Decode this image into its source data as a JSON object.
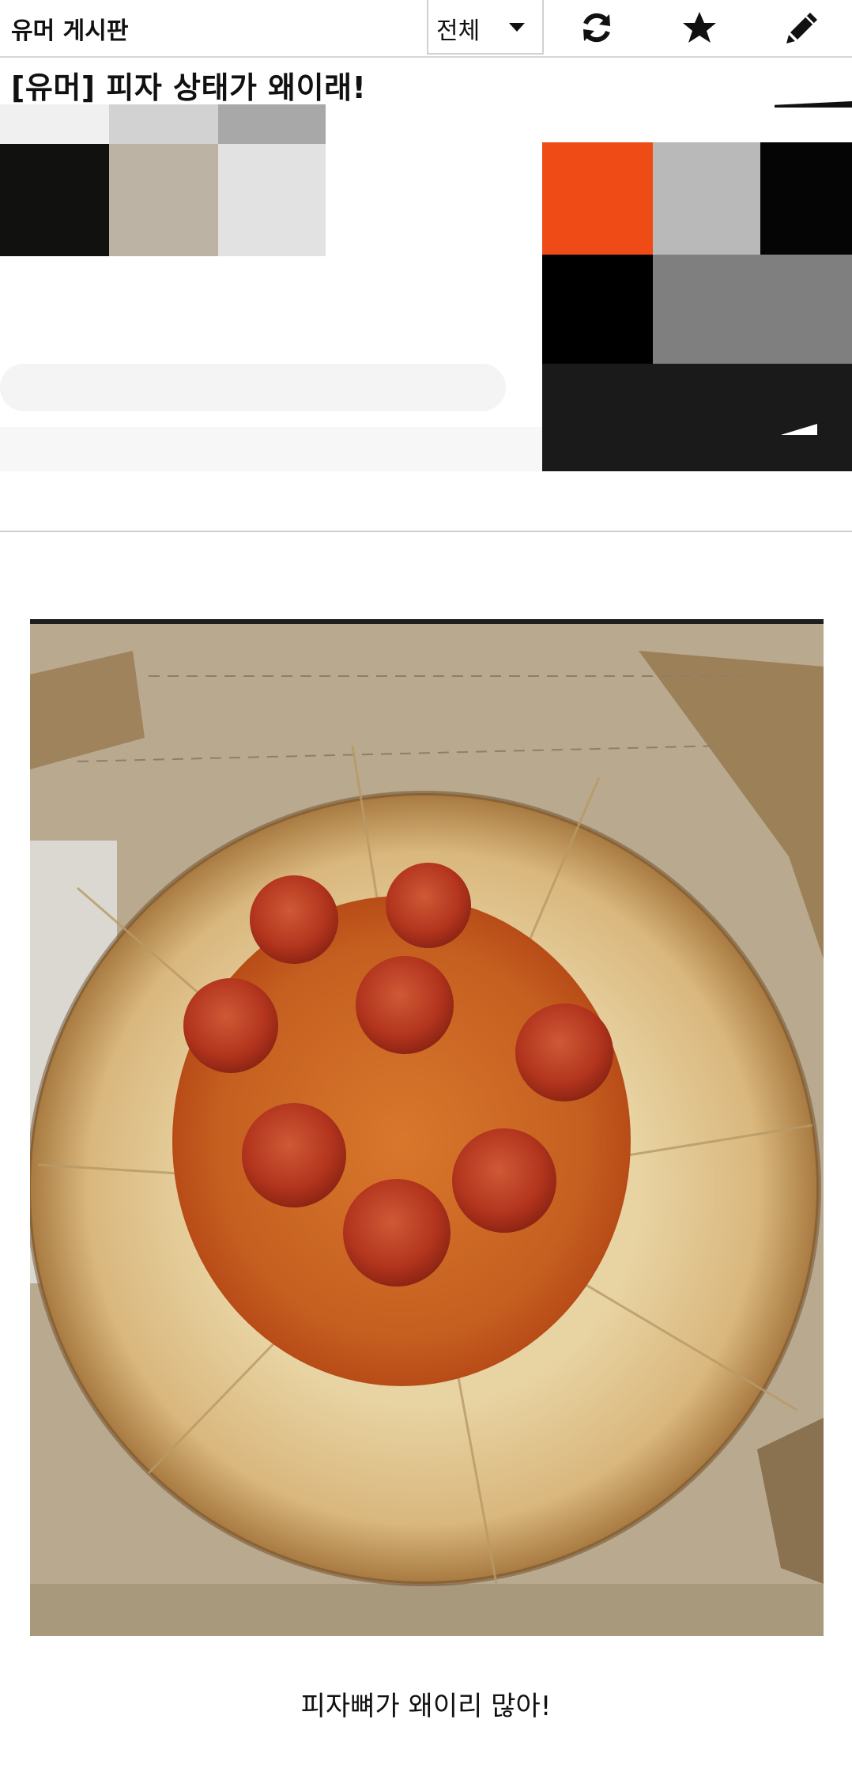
{
  "header": {
    "board_title": "유머 게시판",
    "filter_label": "전체",
    "icons": [
      "refresh-icon",
      "star-icon",
      "pencil-icon"
    ]
  },
  "post": {
    "title": "[유머] 피자 상태가 왜이래!",
    "caption": "피자뼈가 왜이리 많아!"
  },
  "colors": {
    "divider": "#cfcfcf",
    "cardboard": "#b8a488",
    "crust": "#dcc190",
    "sauce": "#c9581e",
    "pepperoni": "#b2341d",
    "mosaic_orange": "#ee4b16"
  }
}
